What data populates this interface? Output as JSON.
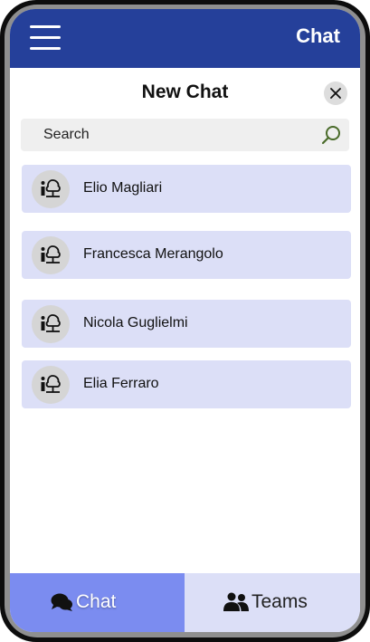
{
  "header": {
    "title": "Chat",
    "menu_icon": "hamburger-menu-icon"
  },
  "dialog": {
    "title": "New Chat",
    "close_icon": "close-icon"
  },
  "search": {
    "placeholder": "Search",
    "value": "",
    "icon": "search-icon"
  },
  "contacts": [
    {
      "name": "Elio Magliari",
      "icon": "person-tree-icon"
    },
    {
      "name": "Francesca Merangolo",
      "icon": "person-tree-icon"
    },
    {
      "name": "Nicola Guglielmi",
      "icon": "person-tree-icon"
    },
    {
      "name": "Elia Ferraro",
      "icon": "person-tree-icon"
    }
  ],
  "bottom_nav": {
    "tabs": [
      {
        "label": "Chat",
        "icon": "chat-bubbles-icon",
        "active": true
      },
      {
        "label": "Teams",
        "icon": "people-icon",
        "active": false
      }
    ]
  },
  "colors": {
    "header": "#25409a",
    "contact_bg": "#dcdff7",
    "active_tab": "#7b8cf0",
    "inactive_tab": "#dcdff7",
    "search_icon": "#4a6b2a"
  }
}
